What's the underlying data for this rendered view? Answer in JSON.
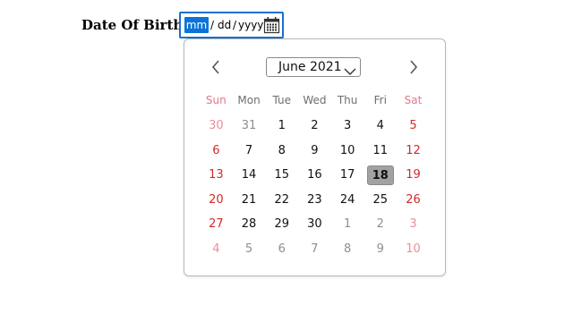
{
  "form": {
    "label": "Date Of Birth",
    "input": {
      "segments": [
        "mm",
        "dd",
        "yyyy"
      ],
      "separator": "/",
      "focused_segment": "mm"
    }
  },
  "picker": {
    "month_label": "June 2021",
    "weekdays": [
      "Sun",
      "Mon",
      "Tue",
      "Wed",
      "Thu",
      "Fri",
      "Sat"
    ],
    "weeks": [
      [
        "30",
        "31",
        "1",
        "2",
        "3",
        "4",
        "5"
      ],
      [
        "6",
        "7",
        "8",
        "9",
        "10",
        "11",
        "12"
      ],
      [
        "13",
        "14",
        "15",
        "16",
        "17",
        "18",
        "19"
      ],
      [
        "20",
        "21",
        "22",
        "23",
        "24",
        "25",
        "26"
      ],
      [
        "27",
        "28",
        "29",
        "30",
        "1",
        "2",
        "3"
      ],
      [
        "4",
        "5",
        "6",
        "7",
        "8",
        "9",
        "10"
      ]
    ],
    "selected_day": "18"
  },
  "colors": {
    "focus_border": "#1a6fd1",
    "segment_highlight": "#0a74da",
    "weekend": "#d12a2a",
    "weekend_muted": "#e8909a",
    "selected_bg": "#a2a2a2"
  },
  "icons": {
    "calendar": "calendar-icon",
    "prev": "chevron-left-icon",
    "next": "chevron-right-icon",
    "dropdown": "chevron-down-icon"
  }
}
